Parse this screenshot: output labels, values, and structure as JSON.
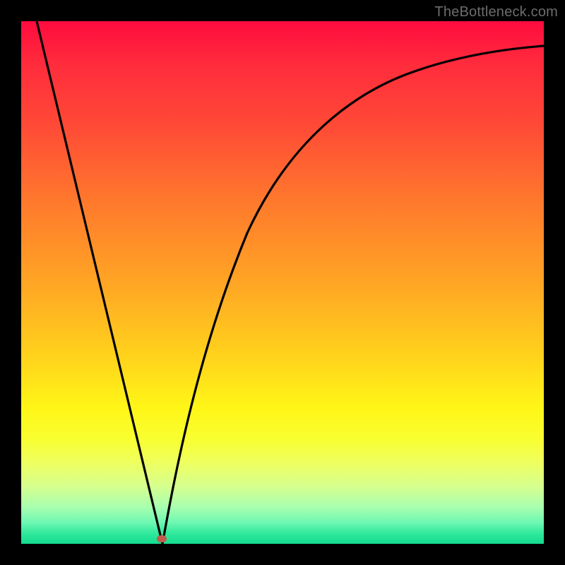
{
  "attribution": "TheBottleneck.com",
  "colors": {
    "background": "#000000",
    "gradient_top": "#ff0b3e",
    "gradient_mid1": "#ffa524",
    "gradient_mid2": "#fff617",
    "gradient_bottom": "#14db8e",
    "curve": "#000000",
    "marker": "#c15a4c"
  },
  "chart_data": {
    "type": "line",
    "title": "",
    "xlabel": "",
    "ylabel": "",
    "xlim": [
      0,
      100
    ],
    "ylim": [
      0,
      100
    ],
    "grid": false,
    "legend": false,
    "series": [
      {
        "name": "curve",
        "x": [
          3,
          6,
          10,
          14,
          18,
          22,
          25,
          26.5,
          27,
          28,
          30,
          34,
          40,
          48,
          56,
          64,
          72,
          80,
          88,
          96,
          100
        ],
        "y": [
          100,
          88,
          72,
          56,
          40,
          24,
          10,
          2,
          0,
          4,
          17,
          36,
          54,
          68,
          77,
          83,
          87,
          90,
          92,
          93.5,
          94
        ]
      }
    ],
    "marker": {
      "x": 27,
      "y": 0
    }
  }
}
